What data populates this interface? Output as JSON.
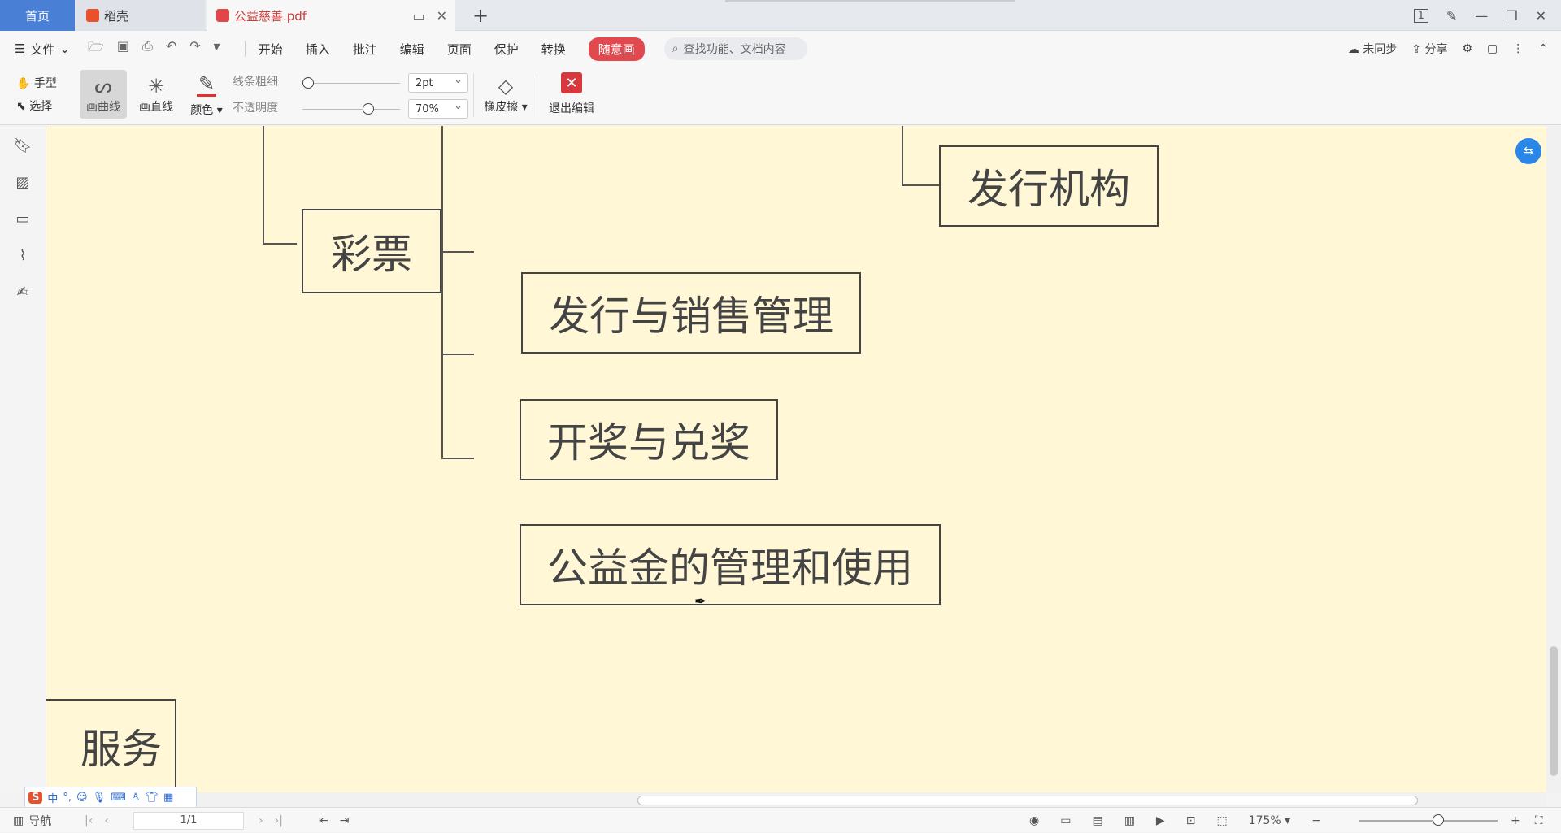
{
  "tabs": {
    "home": "首页",
    "daoke": "稻壳",
    "doc": "公益慈善.pdf"
  },
  "menu": {
    "file": "文件",
    "items": [
      "开始",
      "插入",
      "批注",
      "编辑",
      "页面",
      "保护",
      "转换"
    ],
    "special": "随意画",
    "search_placeholder": "查找功能、文档内容",
    "sync": "未同步",
    "share": "分享"
  },
  "toolbar": {
    "hand": "手型",
    "select": "选择",
    "curve": "画曲线",
    "line": "画直线",
    "color": "颜色",
    "thickness_label": "线条粗细",
    "opacity_label": "不透明度",
    "thickness_value": "2pt",
    "opacity_value": "70%",
    "eraser": "橡皮擦",
    "exit": "退出编辑"
  },
  "mindmap": {
    "n1": "发行机构",
    "n2": "彩票",
    "n3": "发行与销售管理",
    "n4": "开奖与兑奖",
    "n5": "公益金的管理和使用",
    "n6": "服务"
  },
  "statusbar": {
    "nav": "导航",
    "page": "1/1",
    "zoom": "175%"
  },
  "ime": {
    "logo": "S",
    "mode": "中"
  },
  "colors": {
    "accent": "#e1494f",
    "canvas": "#fff7d5",
    "home_tab": "#4a7fd6"
  }
}
